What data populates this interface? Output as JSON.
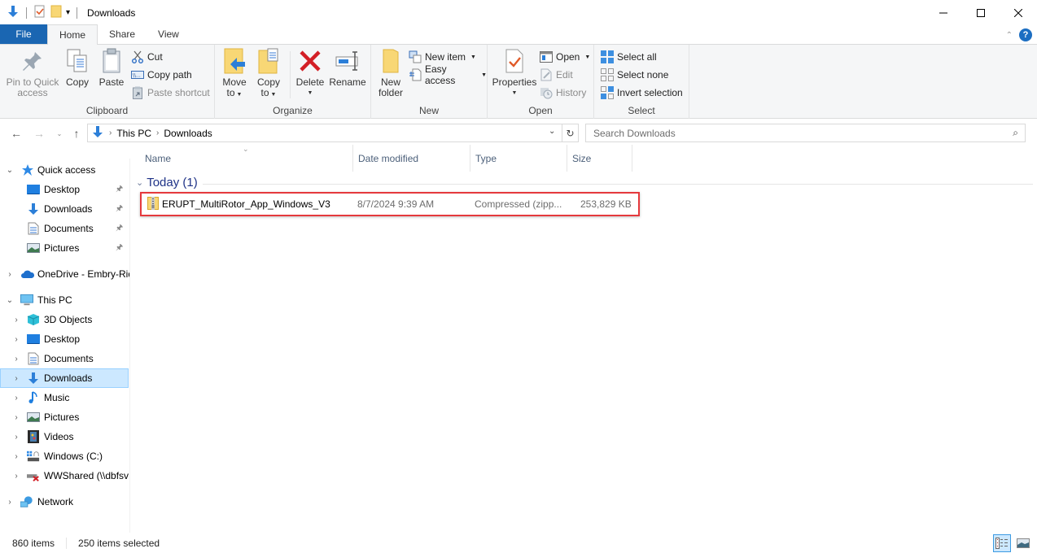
{
  "window": {
    "title": "Downloads",
    "minimize_label": "Minimize",
    "maximize_label": "Maximize",
    "close_label": "Close"
  },
  "ribbon_tabs": [
    {
      "label": "File"
    },
    {
      "label": "Home"
    },
    {
      "label": "Share"
    },
    {
      "label": "View"
    }
  ],
  "ribbon": {
    "clipboard": {
      "label": "Clipboard",
      "pin_line1": "Pin to Quick",
      "pin_line2": "access",
      "copy": "Copy",
      "paste": "Paste",
      "cut": "Cut",
      "copy_path": "Copy path",
      "paste_shortcut": "Paste shortcut"
    },
    "organize": {
      "label": "Organize",
      "move_line1": "Move",
      "move_line2": "to",
      "copy_line1": "Copy",
      "copy_line2": "to",
      "delete": "Delete",
      "rename": "Rename"
    },
    "new": {
      "label": "New",
      "new_folder_line1": "New",
      "new_folder_line2": "folder",
      "new_item": "New item",
      "easy_access": "Easy access"
    },
    "open": {
      "label": "Open",
      "properties": "Properties",
      "open": "Open",
      "edit": "Edit",
      "history": "History"
    },
    "select": {
      "label": "Select",
      "select_all": "Select all",
      "select_none": "Select none",
      "invert_selection": "Invert selection"
    }
  },
  "address": {
    "crumbs": [
      "This PC",
      "Downloads"
    ],
    "search_placeholder": "Search Downloads"
  },
  "sidebar": {
    "quick_access": {
      "label": "Quick access",
      "items": [
        {
          "label": "Desktop",
          "icon": "desktop-icon"
        },
        {
          "label": "Downloads",
          "icon": "downloads-icon"
        },
        {
          "label": "Documents",
          "icon": "documents-icon"
        },
        {
          "label": "Pictures",
          "icon": "pictures-icon"
        }
      ]
    },
    "onedrive": {
      "label": "OneDrive - Embry-Riddle"
    },
    "this_pc": {
      "label": "This PC",
      "items": [
        {
          "label": "3D Objects",
          "icon": "3d-objects-icon"
        },
        {
          "label": "Desktop",
          "icon": "desktop-icon"
        },
        {
          "label": "Documents",
          "icon": "documents-icon"
        },
        {
          "label": "Downloads",
          "icon": "downloads-icon",
          "selected": true
        },
        {
          "label": "Music",
          "icon": "music-icon"
        },
        {
          "label": "Pictures",
          "icon": "pictures-icon"
        },
        {
          "label": "Videos",
          "icon": "videos-icon"
        },
        {
          "label": "Windows (C:)",
          "icon": "drive-icon"
        },
        {
          "label": "WWShared (\\\\dbfsv",
          "icon": "network-drive-disconnected-icon"
        }
      ]
    },
    "network": {
      "label": "Network"
    }
  },
  "file_list": {
    "columns": [
      "Name",
      "Date modified",
      "Type",
      "Size"
    ],
    "group": "Today (1)",
    "files": [
      {
        "name": "ERUPT_MultiRotor_App_Windows_V3",
        "date_modified": "8/7/2024 9:39 AM",
        "type": "Compressed (zipp...",
        "size": "253,829 KB",
        "icon": "zip-folder-icon"
      }
    ]
  },
  "status": {
    "item_count": "860 items",
    "selected_count": "250 items selected"
  },
  "colors": {
    "file_tab": "#1a66b2",
    "selection": "#cce8ff",
    "highlight_box": "#e5393d",
    "group_header": "#1e3287"
  }
}
